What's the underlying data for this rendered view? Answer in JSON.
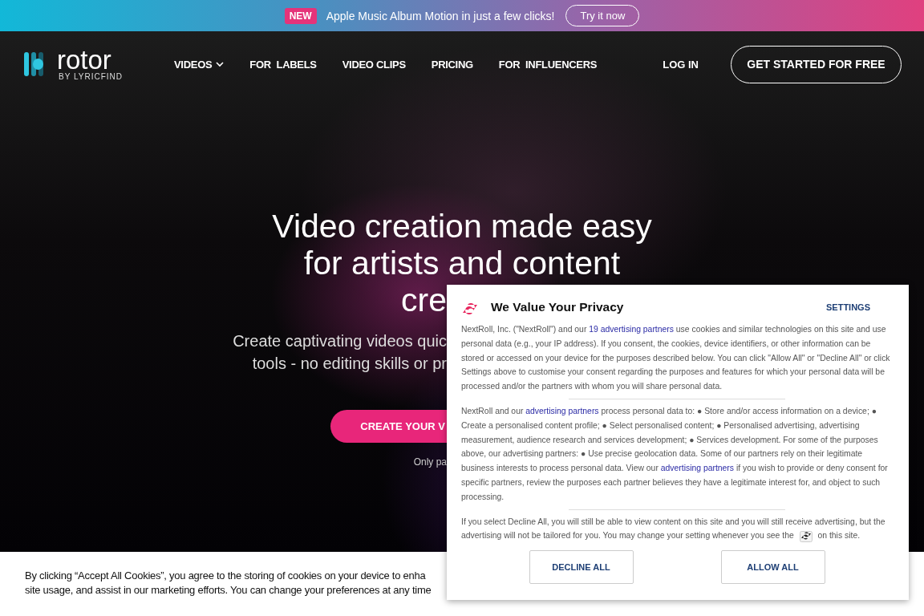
{
  "promo_bar": {
    "badge": "NEW",
    "message": "Apple Music Album Motion in just a few clicks!",
    "button": "Try it now"
  },
  "nav": {
    "logo": {
      "name": "rotor",
      "tagline": "BY LYRICFIND"
    },
    "items": [
      {
        "label": "VIDEOS",
        "dropdown": true
      },
      {
        "label": "FOR  LABELS",
        "dropdown": false
      },
      {
        "label": "VIDEO CLIPS",
        "dropdown": false
      },
      {
        "label": "PRICING",
        "dropdown": false
      },
      {
        "label": "FOR  INFLUENCERS",
        "dropdown": false
      }
    ],
    "login": "LOG IN",
    "cta": "GET STARTED FOR FREE"
  },
  "hero": {
    "headline": [
      "Video creation made easy",
      "for artists and content"
    ],
    "headline_visible_part": "cre",
    "subtitle_visible_parts": [
      "Create captivating videos quic",
      "tools - no editing skills or pr"
    ],
    "button_visible_part": "CREATE YOUR V",
    "note_visible_part": "Only pa"
  },
  "cookie_banner": {
    "lines": [
      "By clicking “Accept All Cookies”, you agree to the storing of cookies on your device to enha",
      "site usage, and assist in our marketing efforts. You can change your preferences at any time"
    ]
  },
  "privacy_dialog": {
    "title": "We Value Your Privacy",
    "settings": "SETTINGS",
    "paragraphs": [
      [
        {
          "kind": "text",
          "text": "NextRoll, Inc. (\"NextRoll\") and our "
        },
        {
          "kind": "link",
          "text": "19 advertising partners"
        },
        {
          "kind": "text",
          "text": " use cookies and similar technologies on this site and use personal data (e.g., your IP address). If you consent, the cookies, device identifiers, or other information can be stored or accessed on your device for the purposes described below. You can click \"Allow All\" or \"Decline All\" or click Settings above to customise your consent regarding the purposes and features for which your personal data will be processed and/or the partners with whom you will share personal data."
        }
      ],
      [
        {
          "kind": "text",
          "text": "NextRoll and our "
        },
        {
          "kind": "link",
          "text": "advertising partners"
        },
        {
          "kind": "text",
          "text": " process personal data to: ● Store and/or access information on a device; ● Create a personalised content profile; ● Select personalised content; ● Personalised advertising, advertising measurement, audience research and services development; ● Services development. For some of the purposes above, our advertising partners: ● Use precise geolocation data. Some of our partners rely on their legitimate business interests to process personal data. View our "
        },
        {
          "kind": "link",
          "text": "advertising partners"
        },
        {
          "kind": "text",
          "text": " if you wish to provide or deny consent for specific partners, review the purposes each partner believes they have a legitimate interest for, and object to such processing."
        }
      ],
      [
        {
          "kind": "text",
          "text": "If you select Decline All, you will still be able to view content on this site and you will still receive advertising, but the advertising will not be tailored for you. You may change your setting whenever you see the "
        },
        {
          "kind": "icon"
        },
        {
          "kind": "text",
          "text": " on this site."
        }
      ]
    ],
    "buttons": [
      "DECLINE ALL",
      "ALLOW ALL"
    ]
  }
}
